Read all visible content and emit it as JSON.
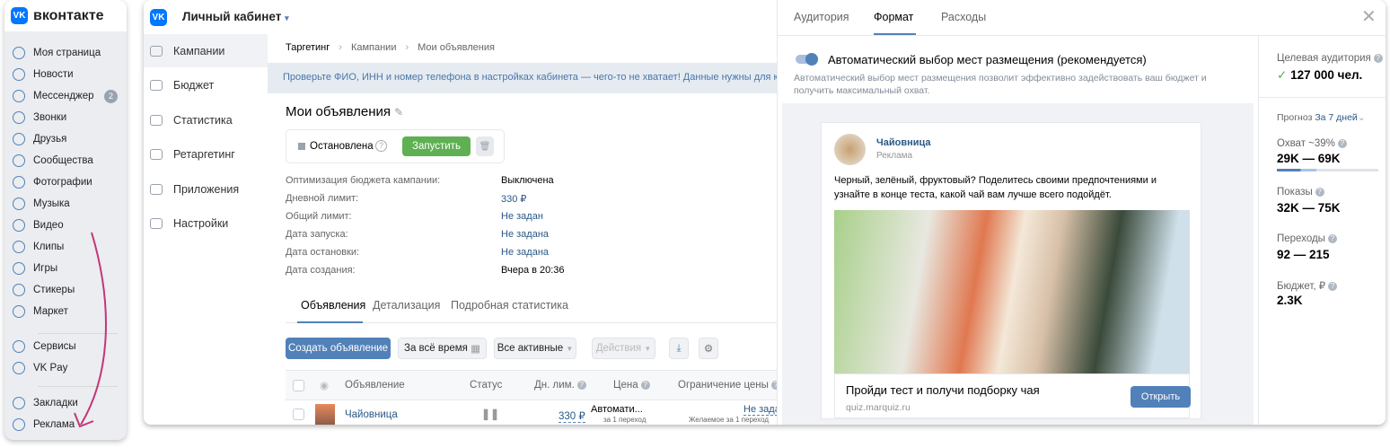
{
  "vk_sidebar": {
    "brand": "вконтакте",
    "items": [
      {
        "label": "Моя страница",
        "icon": "user-circle-icon"
      },
      {
        "label": "Новости",
        "icon": "news-icon"
      },
      {
        "label": "Мессенджер",
        "icon": "message-icon",
        "badge": "2"
      },
      {
        "label": "Звонки",
        "icon": "phone-icon"
      },
      {
        "label": "Друзья",
        "icon": "friends-icon"
      },
      {
        "label": "Сообщества",
        "icon": "communities-icon"
      },
      {
        "label": "Фотографии",
        "icon": "photo-icon"
      },
      {
        "label": "Музыка",
        "icon": "music-icon"
      },
      {
        "label": "Видео",
        "icon": "video-icon"
      },
      {
        "label": "Клипы",
        "icon": "clips-icon"
      },
      {
        "label": "Игры",
        "icon": "gamepad-icon"
      },
      {
        "label": "Стикеры",
        "icon": "smile-icon"
      },
      {
        "label": "Маркет",
        "icon": "bag-icon"
      },
      {
        "label": "Сервисы",
        "icon": "services-icon"
      },
      {
        "label": "VK Pay",
        "icon": "vkpay-icon"
      },
      {
        "label": "Закладки",
        "icon": "bookmark-icon"
      },
      {
        "label": "Реклама",
        "icon": "megaphone-icon"
      }
    ]
  },
  "header": {
    "title": "Личный кабинет"
  },
  "nav": [
    {
      "label": "Кампании"
    },
    {
      "label": "Бюджет"
    },
    {
      "label": "Статистика"
    },
    {
      "label": "Ретаргетинг"
    },
    {
      "label": "Приложения"
    },
    {
      "label": "Настройки"
    }
  ],
  "breadcrumb": [
    "Таргетинг",
    "Кампании",
    "Мои объявления"
  ],
  "banner": "Проверьте ФИО, ИНН и номер телефона в настройках кабинета — чего-то не хватает! Данные нужны для ко",
  "campaign": {
    "title": "Мои объявления",
    "status": "Остановлена",
    "start_label": "Запустить",
    "props": [
      {
        "label": "Оптимизация бюджета кампании:",
        "value": "Выключена",
        "link": false
      },
      {
        "label": "Дневной лимит:",
        "value": "330 ₽",
        "link": true
      },
      {
        "label": "Общий лимит:",
        "value": "Не задан",
        "link": true
      },
      {
        "label": "Дата запуска:",
        "value": "Не задана",
        "link": true
      },
      {
        "label": "Дата остановки:",
        "value": "Не задана",
        "link": true
      },
      {
        "label": "Дата создания:",
        "value": "Вчера в 20:36",
        "link": false
      }
    ]
  },
  "tabs": [
    "Объявления",
    "Детализация",
    "Подробная статистика"
  ],
  "toolbar": {
    "create": "Создать объявление",
    "period": "За всё время",
    "filter": "Все активные",
    "actions": "Действия"
  },
  "table": {
    "headers": [
      "Объявление",
      "Статус",
      "Дн. лим.",
      "Цена",
      "Ограничение цены"
    ],
    "rows": [
      {
        "name": "Чайовница",
        "limit": "330 ₽",
        "price": "Автомати...",
        "price_sub": "за 1 переход",
        "cap": "Не задано",
        "cap_sub": "Желаемое за 1 переход"
      }
    ]
  },
  "panel": {
    "tabs": [
      "Аудитория",
      "Формат",
      "Расходы"
    ],
    "toggle_label": "Автоматический выбор мест размещения (рекомендуется)",
    "toggle_on": true,
    "toggle_desc": "Автоматический выбор мест размещения позволит эффективно задействовать ваш бюджет и получить максимальный охват.",
    "post": {
      "author": "Чайовница",
      "sub": "Реклама",
      "text": "Черный, зелёный, фруктовый? Поделитесь своими предпочтениями и узнайте в конце теста, какой чай вам лучше всего подойдёт.",
      "cta_title": "Пройди тест и получи подборку чая",
      "domain": "quiz.marquiz.ru",
      "cta_button": "Открыть"
    }
  },
  "stats": {
    "audience_label": "Целевая аудитория",
    "audience_value": "127 000 чел.",
    "forecast_label": "Прогноз",
    "forecast_period": "За 7 дней",
    "reach_label": "Охват ~39%",
    "reach_value": "29K — 69K",
    "reach_fill": 0.39,
    "shows_label": "Показы",
    "shows_value": "32K — 75K",
    "clicks_label": "Переходы",
    "clicks_value": "92 — 215",
    "budget_label": "Бюджет, ₽",
    "budget_value": "2.3K"
  },
  "colors": {
    "accent": "#5181b8",
    "green": "#5fb053",
    "banner": "#e5ebf1",
    "arrow": "#c4357a"
  }
}
